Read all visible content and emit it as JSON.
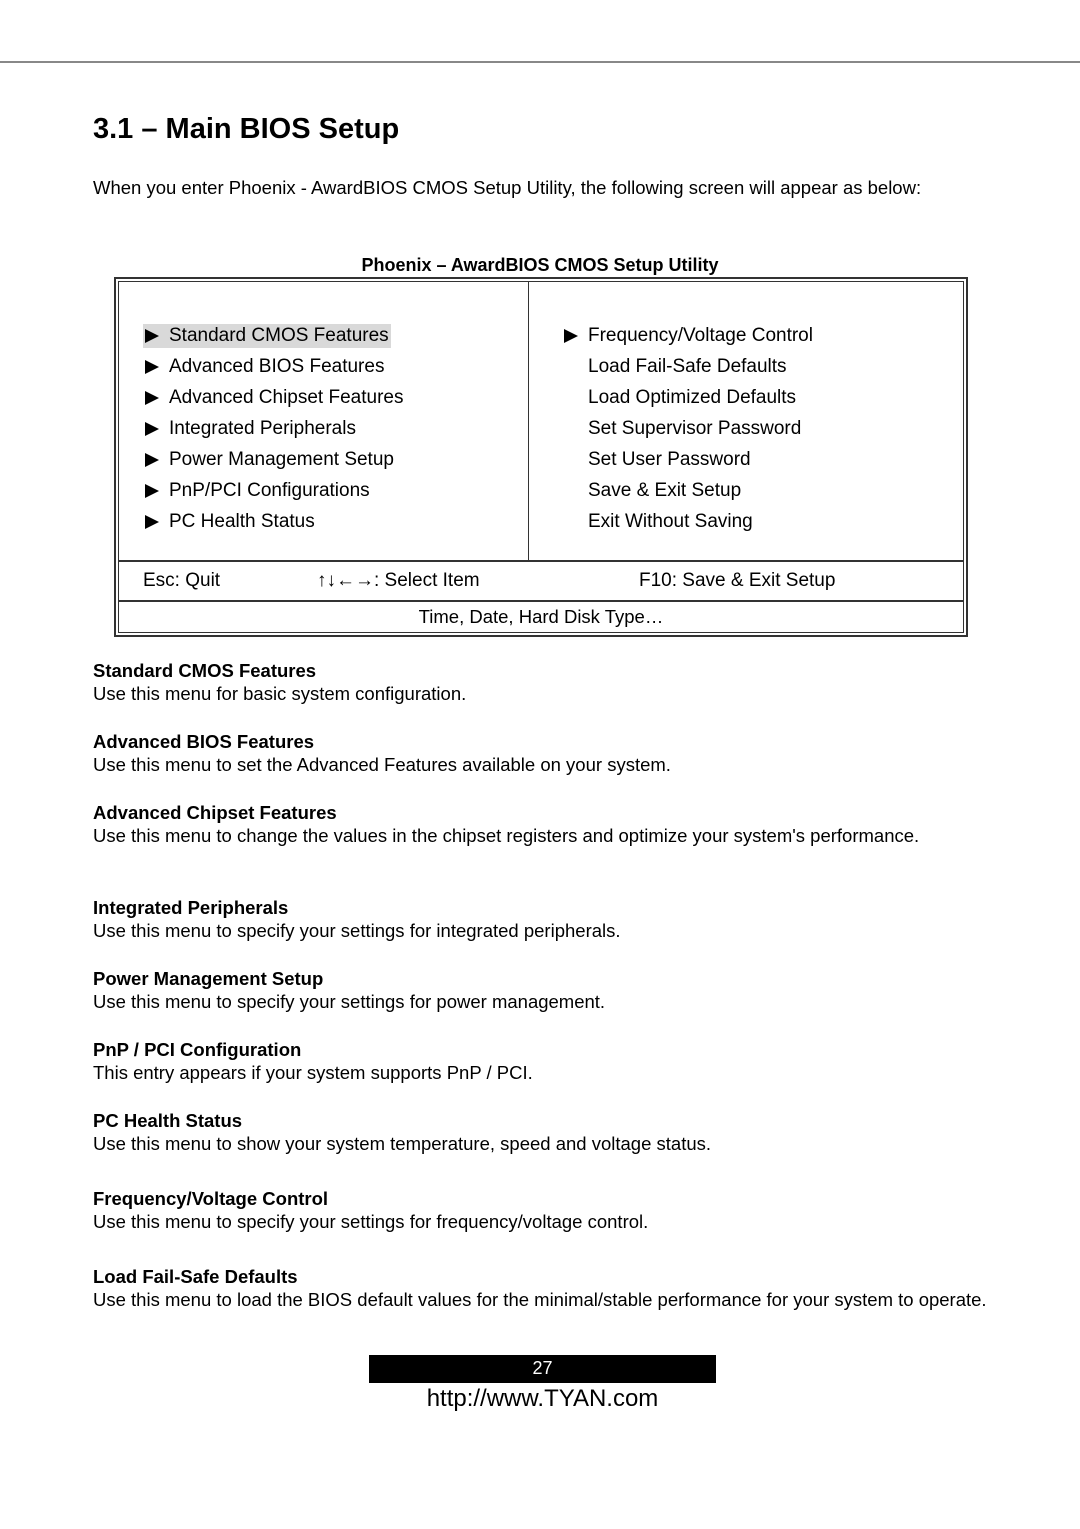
{
  "page": {
    "title": "3.1 – Main BIOS Setup",
    "intro": "When you enter Phoenix - AwardBIOS CMOS Setup Utility, the following screen will appear as below:"
  },
  "bios_screen": {
    "title": "Phoenix – AwardBIOS CMOS Setup Utility",
    "highlight_color": "#d9d9d9",
    "left_menu": [
      {
        "label": "Standard CMOS Features",
        "has_submenu": true,
        "selected": true
      },
      {
        "label": "Advanced BIOS Features",
        "has_submenu": true,
        "selected": false
      },
      {
        "label": "Advanced Chipset Features",
        "has_submenu": true,
        "selected": false
      },
      {
        "label": "Integrated Peripherals",
        "has_submenu": true,
        "selected": false
      },
      {
        "label": "Power Management Setup",
        "has_submenu": true,
        "selected": false
      },
      {
        "label": "PnP/PCI Configurations",
        "has_submenu": true,
        "selected": false
      },
      {
        "label": "PC Health Status",
        "has_submenu": true,
        "selected": false
      }
    ],
    "right_menu": [
      {
        "label": "Frequency/Voltage Control",
        "has_submenu": true,
        "selected": false
      },
      {
        "label": "Load Fail-Safe Defaults",
        "has_submenu": false,
        "selected": false
      },
      {
        "label": "Load Optimized Defaults",
        "has_submenu": false,
        "selected": false
      },
      {
        "label": "Set Supervisor Password",
        "has_submenu": false,
        "selected": false
      },
      {
        "label": "Set User Password",
        "has_submenu": false,
        "selected": false
      },
      {
        "label": "Save & Exit Setup",
        "has_submenu": false,
        "selected": false
      },
      {
        "label": "Exit Without Saving",
        "has_submenu": false,
        "selected": false
      }
    ],
    "keys": {
      "esc": "Esc:  Quit",
      "arrows": "↑↓←→: Select Item",
      "f10": "F10:  Save & Exit Setup"
    },
    "help_text": "Time, Date, Hard Disk Type…"
  },
  "sections": [
    {
      "heading": "Standard CMOS Features",
      "body": "Use this menu for basic system configuration."
    },
    {
      "heading": "Advanced BIOS Features",
      "body": "Use this menu to set the Advanced Features available on your system."
    },
    {
      "heading": "Advanced Chipset Features",
      "body": "Use this menu to change the values in the chipset registers and optimize your system's performance."
    },
    {
      "heading": "Integrated Peripherals",
      "body": "Use this menu to specify your settings for integrated peripherals."
    },
    {
      "heading": "Power Management Setup",
      "body": "Use this menu to specify your settings for power management."
    },
    {
      "heading": "PnP / PCI Configuration",
      "body": "This entry appears if your system supports PnP / PCI."
    },
    {
      "heading": "PC Health Status",
      "body": "Use this menu to show your system temperature, speed and voltage status."
    },
    {
      "heading": "Frequency/Voltage Control",
      "body": "Use this menu to specify your settings for frequency/voltage control."
    },
    {
      "heading": "Load Fail-Safe Defaults",
      "body": "Use this menu to load the BIOS default values for the minimal/stable performance for your system to operate."
    }
  ],
  "footer": {
    "page_number": "27",
    "url": "http://www.TYAN.com"
  }
}
